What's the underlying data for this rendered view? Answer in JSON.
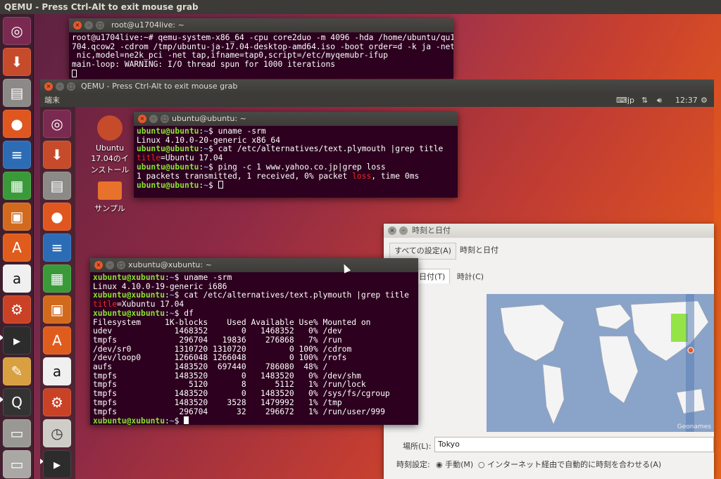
{
  "outer": {
    "title": "QEMU - Press Ctrl-Alt to exit mouse grab",
    "terminal": {
      "title": "root@u1704live: ~",
      "lines": [
        "root@u1704live:~# qemu-system-x86_64 -cpu core2duo -m 4096 -hda /home/ubuntu/qu1",
        "704.qcow2 -cdrom /tmp/ubuntu-ja-17.04-desktop-amd64.iso -boot order=d -k ja -net",
        " nic,model=ne2k_pci -net tap,ifname=tap0,script=/etc/myqemubr-ifup",
        "main-loop: WARNING: I/O thread spun for 1000 iterations"
      ]
    }
  },
  "qemu": {
    "title": "QEMU - Press Ctrl-Alt to exit mouse grab",
    "panel": {
      "app_name": "端末",
      "keyboard": "jp",
      "clock": "12:37"
    },
    "desktop_icons": [
      {
        "label": "Ubuntu 17.04のインストール"
      },
      {
        "label": "サンプル"
      }
    ],
    "ubuntu_terminal": {
      "title": "ubuntu@ubuntu: ~",
      "prompt_user": "ubuntu@ubuntu",
      "cmd1": "uname -srm",
      "out1": "Linux 4.10.0-20-generic x86_64",
      "cmd2": "cat /etc/alternatives/text.plymouth |grep title",
      "out2_key": "title",
      "out2_val": "=Ubuntu 17.04",
      "cmd3": "ping -c 1 www.yahoo.co.jp|grep loss",
      "out3_a": "1 packets transmitted, 1 received, 0% packet ",
      "out3_hl": "loss",
      "out3_b": ", time 0ms"
    },
    "xubuntu_terminal": {
      "title": "xubuntu@xubuntu: ~",
      "prompt_user": "xubuntu@xubuntu",
      "cmd1": "uname -srm",
      "out1": "Linux 4.10.0-19-generic i686",
      "cmd2": "cat /etc/alternatives/text.plymouth |grep title",
      "out2_key": "title",
      "out2_val": "=Xubuntu 17.04",
      "cmd3": "df",
      "df_header": "Filesystem     1K-blocks    Used Available Use% Mounted on",
      "df_rows": [
        "udev             1468352       0   1468352   0% /dev",
        "tmpfs             296704   19836    276868   7% /run",
        "/dev/sr0         1310720 1310720         0 100% /cdrom",
        "/dev/loop0       1266048 1266048         0 100% /rofs",
        "aufs             1483520  697440    786080  48% /",
        "tmpfs            1483520       0   1483520   0% /dev/shm",
        "tmpfs               5120       8      5112   1% /run/lock",
        "tmpfs            1483520       0   1483520   0% /sys/fs/cgroup",
        "tmpfs            1483520    3528   1479992   1% /tmp",
        "tmpfs             296704      32    296672   1% /run/user/999"
      ]
    },
    "datetime": {
      "title": "時刻と日付",
      "all_settings": "すべての設定(A)",
      "crumb": "時刻と日付",
      "tab1": "時刻と日付(T)",
      "tab2": "時計(C)",
      "map_credit": "Geonames",
      "location_label": "場所(L):",
      "location_value": "Tokyo",
      "time_setting_label": "時刻設定:",
      "manual": "手動(M)",
      "internet": "インターネット経由で自動的に時刻を合わせる(A)"
    }
  }
}
